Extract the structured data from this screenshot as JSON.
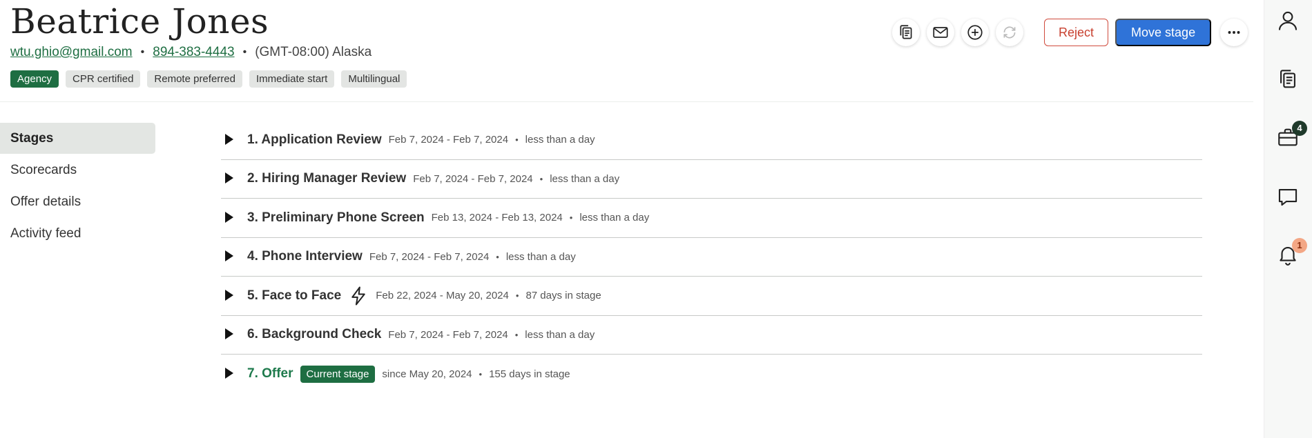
{
  "candidate": {
    "name": "Beatrice Jones",
    "email": "wtu.ghio@gmail.com",
    "phone": "894-383-4443",
    "timezone": "(GMT-08:00) Alaska",
    "separator": "•"
  },
  "tags": [
    {
      "label": "Agency",
      "primary": true
    },
    {
      "label": "CPR certified"
    },
    {
      "label": "Remote preferred"
    },
    {
      "label": "Immediate start"
    },
    {
      "label": "Multilingual"
    }
  ],
  "actions": {
    "reject_label": "Reject",
    "move_label": "Move stage",
    "icons": [
      "copy-icon",
      "mail-icon",
      "add-circle-icon",
      "refresh-icon",
      "more-horizontal-icon"
    ]
  },
  "nav": {
    "items": [
      {
        "label": "Stages",
        "active": true
      },
      {
        "label": "Scorecards"
      },
      {
        "label": "Offer details"
      },
      {
        "label": "Activity feed"
      }
    ]
  },
  "stages": [
    {
      "title": "1. Application Review",
      "dates": "Feb 7, 2024 - Feb 7, 2024",
      "duration": "less than a day"
    },
    {
      "title": "2. Hiring Manager Review",
      "dates": "Feb 7, 2024 - Feb 7, 2024",
      "duration": "less than a day"
    },
    {
      "title": "3. Preliminary Phone Screen",
      "dates": "Feb 13, 2024 - Feb 13, 2024",
      "duration": "less than a day"
    },
    {
      "title": "4. Phone Interview",
      "dates": "Feb 7, 2024 - Feb 7, 2024",
      "duration": "less than a day"
    },
    {
      "title": "5. Face to Face",
      "dates": "Feb 22, 2024 - May 20, 2024",
      "duration": "87 days in stage",
      "icon": "lightning-icon"
    },
    {
      "title": "6. Background Check",
      "dates": "Feb 7, 2024 - Feb 7, 2024",
      "duration": "less than a day"
    },
    {
      "title": "7. Offer",
      "badge": "Current stage",
      "dates": "since May 20, 2024",
      "duration": "155 days in stage",
      "current": true
    }
  ],
  "stage_separator": "•",
  "rail": {
    "icons": [
      "user-icon",
      "copy-icon",
      "briefcase-icon",
      "chat-icon",
      "bell-icon"
    ],
    "briefcase_badge": "4",
    "bell_badge": "1"
  },
  "colors": {
    "brand_green": "#1e6e42",
    "primary_blue": "#2f73d8",
    "reject_red": "#c8402f"
  }
}
